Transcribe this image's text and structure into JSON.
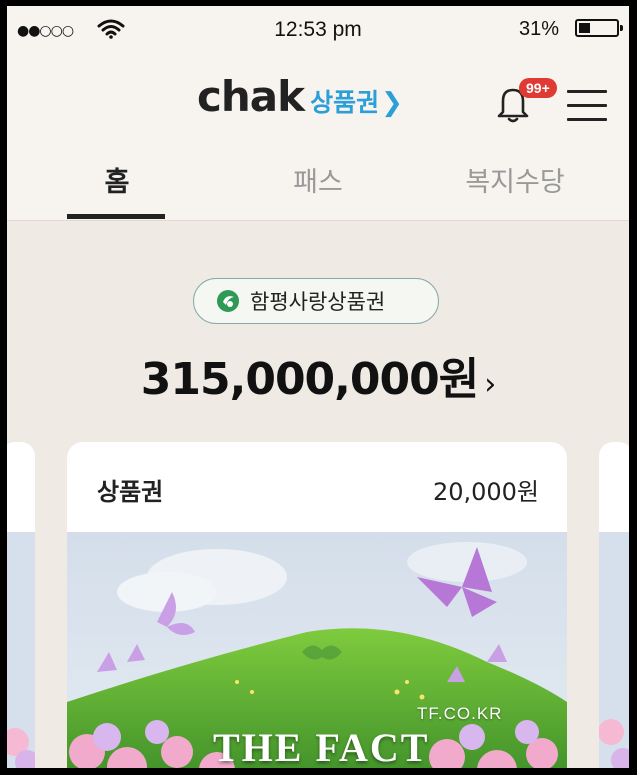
{
  "status_bar": {
    "time": "12:53 pm",
    "battery_percent": "31%",
    "battery_level": 0.31,
    "signal": "●●○○○"
  },
  "header": {
    "logo_main": "chak",
    "logo_sub": "상품권",
    "logo_arrow": "❯",
    "notification_badge": "99+"
  },
  "tabs": [
    {
      "label": "홈",
      "active": true
    },
    {
      "label": "패스",
      "active": false
    },
    {
      "label": "복지수당",
      "active": false
    }
  ],
  "voucher": {
    "name": "함평사랑상품권",
    "balance": "315,000,000원",
    "chevron": "›"
  },
  "card": {
    "title": "상품권",
    "value": "20,000원"
  },
  "watermark": {
    "small": "TF.CO.KR",
    "big": "THE FACT"
  },
  "colors": {
    "accent": "#2d9fd8",
    "badge": "#e03a34",
    "background": "#f7f4ef"
  }
}
